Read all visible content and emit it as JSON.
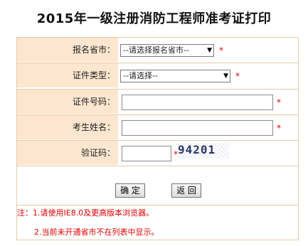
{
  "page_title": "2015年一级注册消防工程师准考证打印",
  "form": {
    "province_label": "报名省市：",
    "province_select_value": "--请选择报名省市--",
    "cert_type_label": "证件类型：",
    "cert_type_select_value": "--请选择--",
    "cert_number_label": "证件号码：",
    "cert_number_value": "",
    "name_label": "考生姓名：",
    "name_value": "",
    "captcha_label": "验证码：",
    "captcha_value": "",
    "captcha_image_text": "94201",
    "required_mark": "*"
  },
  "buttons": {
    "confirm_label": "确 定",
    "back_label": "返 回"
  },
  "notes": {
    "line1": "注：1.请使用IE8.0及更高版本浏览器。",
    "line2": "2.当前未开通省市不在列表中显示。"
  },
  "colors": {
    "row_background": "#fce6cf",
    "border": "#e7c9a9",
    "required_red": "#e00000"
  }
}
